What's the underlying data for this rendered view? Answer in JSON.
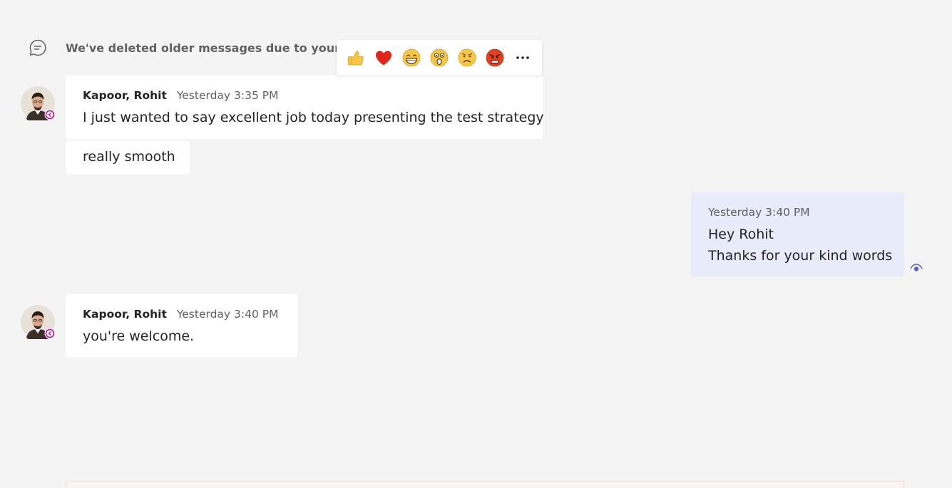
{
  "system_notice": {
    "text": "We've deleted older messages due to your org",
    "icon": "chat-bubble-icon"
  },
  "reaction_bar": {
    "items": [
      {
        "name": "like",
        "icon": "thumbs-up-icon"
      },
      {
        "name": "heart",
        "icon": "heart-icon"
      },
      {
        "name": "laugh",
        "icon": "laugh-icon"
      },
      {
        "name": "surprised",
        "icon": "surprised-icon"
      },
      {
        "name": "sad",
        "icon": "sad-icon"
      },
      {
        "name": "angry",
        "icon": "angry-icon"
      }
    ],
    "more_label": "···"
  },
  "messages": [
    {
      "author": "Kapoor, Rohit",
      "time": "Yesterday 3:35 PM",
      "lines": [
        "I just wanted to say excellent job today presenting the test strategy"
      ],
      "continuation": "really smooth"
    },
    {
      "own": true,
      "time": "Yesterday 3:40 PM",
      "lines": [
        "Hey Rohit",
        "Thanks for your kind words"
      ]
    },
    {
      "author": "Kapoor, Rohit",
      "time": "Yesterday 3:40 PM",
      "lines": [
        "you're welcome."
      ]
    }
  ],
  "colors": {
    "background": "#f4f4f4",
    "own_bubble": "#e8ebfa",
    "accent": "#5b5fc7",
    "presence_external": "#b4009e"
  }
}
